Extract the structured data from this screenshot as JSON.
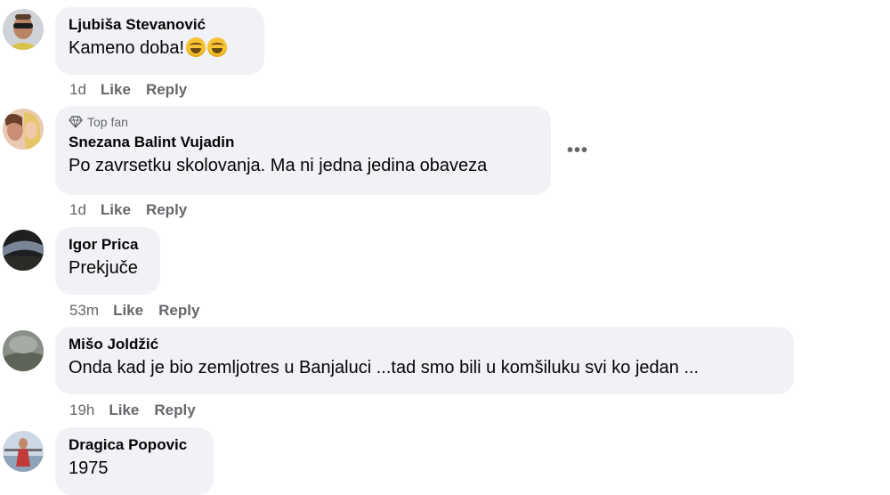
{
  "comments": [
    {
      "author": "Ljubiša Stevanović",
      "text": "Kameno doba!",
      "emoji": [
        "grinning-face-emoji",
        "grinning-face-emoji"
      ],
      "time": "1d",
      "like": "Like",
      "reply": "Reply"
    },
    {
      "badge": "Top fan",
      "author": "Snezana Balint Vujadin",
      "text": "Po zavrsetku skolovanja. Ma ni jedna jedina obaveza",
      "more": "•••",
      "time": "1d",
      "like": "Like",
      "reply": "Reply"
    },
    {
      "author": "Igor Prica",
      "text": "Prekjuče",
      "time": "53m",
      "like": "Like",
      "reply": "Reply"
    },
    {
      "author": "Mišo Joldžić",
      "text": "Onda kad je bio zemljotres u Banjaluci ...tad smo bili u komšiluku svi ko jedan ...",
      "time": "19h",
      "like": "Like",
      "reply": "Reply"
    },
    {
      "author": "Dragica Popovic",
      "text": "1975"
    }
  ],
  "colors": {
    "bubble": "#f0f2f5",
    "meta": "#65676b",
    "text": "#050505"
  }
}
